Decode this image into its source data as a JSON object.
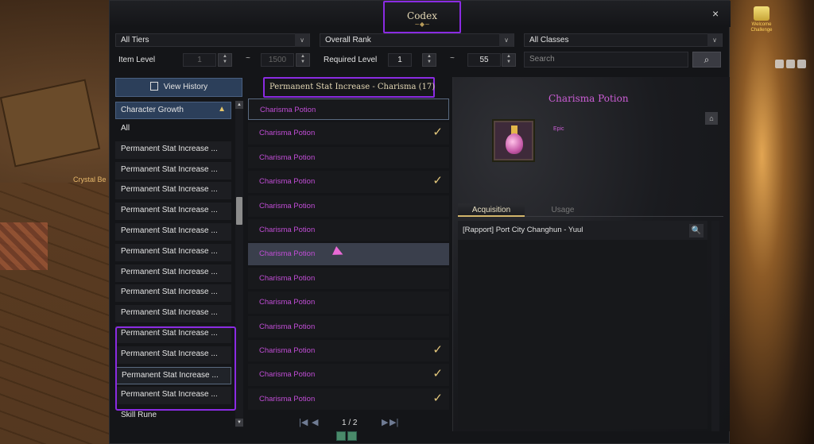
{
  "background": {
    "crystal_label": "Crystal Be",
    "welcome_label": "Welcome Challenge"
  },
  "window": {
    "title": "Codex",
    "title_deco": "~◆~",
    "close_icon": "×"
  },
  "filters": {
    "tier": "All Tiers",
    "rank": "Overall Rank",
    "classes": "All Classes",
    "item_level_label": "Item Level",
    "item_level_min": "1",
    "item_level_max": "1500",
    "required_level_label": "Required Level",
    "required_level_min": "1",
    "required_level_max": "55",
    "range_sep": "~",
    "search_placeholder": "Search",
    "chevron": "∨"
  },
  "left_panel": {
    "view_history": "View History",
    "category_header": "Character Growth",
    "up_icon": "▲",
    "items": [
      "All",
      "Permanent Stat Increase ...",
      "Permanent Stat Increase ...",
      "Permanent Stat Increase ...",
      "Permanent Stat Increase ...",
      "Permanent Stat Increase ...",
      "Permanent Stat Increase ...",
      "Permanent Stat Increase ...",
      "Permanent Stat Increase ...",
      "Permanent Stat Increase ...",
      "Permanent Stat Increase ...",
      "Permanent Stat Increase ...",
      "Permanent Stat Increase ...",
      "Permanent Stat Increase ...",
      "Skill Rune"
    ]
  },
  "middle_panel": {
    "header": "Permanent Stat Increase - Charisma (17)",
    "items": [
      {
        "name": "Charisma Potion",
        "check": ""
      },
      {
        "name": "Charisma Potion",
        "check": "✓"
      },
      {
        "name": "Charisma Potion",
        "check": ""
      },
      {
        "name": "Charisma Potion",
        "check": "✓"
      },
      {
        "name": "Charisma Potion",
        "check": ""
      },
      {
        "name": "Charisma Potion",
        "check": ""
      },
      {
        "name": "Charisma Potion",
        "check": ""
      },
      {
        "name": "Charisma Potion",
        "check": ""
      },
      {
        "name": "Charisma Potion",
        "check": ""
      },
      {
        "name": "Charisma Potion",
        "check": ""
      },
      {
        "name": "Charisma Potion",
        "check": "✓"
      },
      {
        "name": "Charisma Potion",
        "check": "✓"
      },
      {
        "name": "Charisma Potion",
        "check": "✓"
      }
    ],
    "pager": {
      "first": "|◀",
      "prev": "◀",
      "page": "1 / 2",
      "next": "▶",
      "last": "▶|"
    }
  },
  "detail": {
    "title": "Charisma Potion",
    "rarity": "Epic",
    "home_icon": "⌂",
    "tabs": [
      "Acquisition",
      "Usage"
    ],
    "acquisition": "[Rapport] Port City Changhun - Yuul",
    "search_icon": "🔍"
  }
}
